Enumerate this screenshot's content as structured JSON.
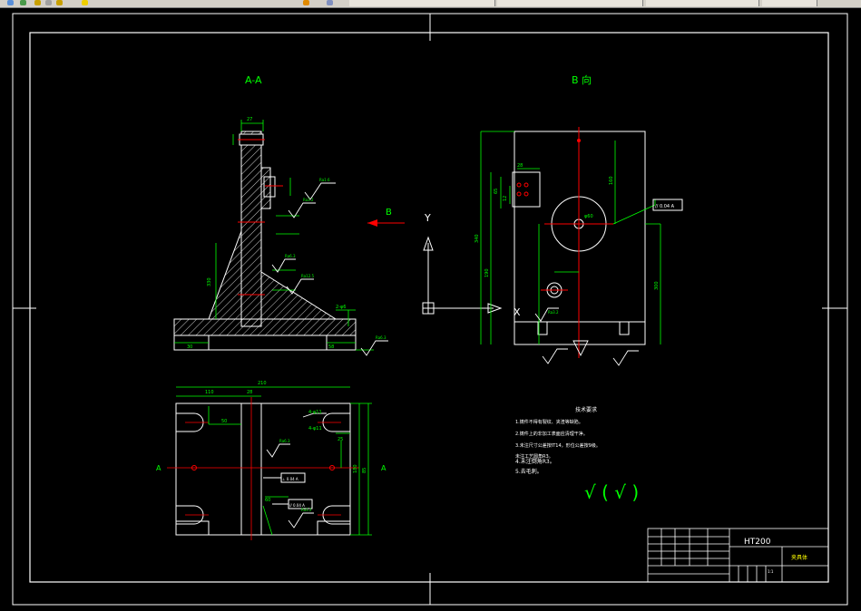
{
  "drawing": {
    "section_aa_title": "A-A",
    "view_b_title": "B 向",
    "arrow_b_label": "B",
    "ucs_y_label": "Y",
    "ucs_x_label": "X",
    "section_mark_left": "A",
    "section_mark_right": "A",
    "tech_title": "技术要求",
    "tech_items": [
      "1.铸件不得有裂纹、夹渣等缺陷。",
      "2.铸件上的非加工表面应清理干净。",
      "3.未注尺寸公差按IT14，形位公差按9级。",
      "未注工艺圆角R3。",
      "4.未注倒角R3。",
      "5.去毛刺。"
    ],
    "rough_symbols": "√ ( √ )",
    "title_material": "HT200",
    "title_name": "夹具体",
    "title_scale": "1:1",
    "dims": {
      "d27": "27",
      "d210": "210",
      "d110": "110",
      "d28": "28",
      "d50": "50",
      "d58": "58",
      "d4phi": "4-φ11",
      "d25": "25",
      "d85": "85",
      "d180": "180",
      "d65": "65",
      "d12": "12",
      "d330": "330",
      "d190": "190",
      "d160": "160",
      "d60": "60",
      "d300": "300",
      "phi60": "φ60",
      "ra16": "Ra1.6",
      "ra32": "Ra3.2",
      "ra63": "Ra6.3",
      "ra125": "Ra12.5",
      "tol1": "// 0.04 A",
      "tol2": "⊥ 0.04 A",
      "tol3": "// 0.04 A",
      "d130": "130",
      "d30": "30",
      "d340": "340",
      "d2phi": "2-φ6"
    }
  },
  "colors": {
    "background": "#000000",
    "outline": "#ffffff",
    "dimension": "#00ff00",
    "center": "#ff0000",
    "title_text": "#ffff00",
    "hatch": "#ffffff"
  }
}
